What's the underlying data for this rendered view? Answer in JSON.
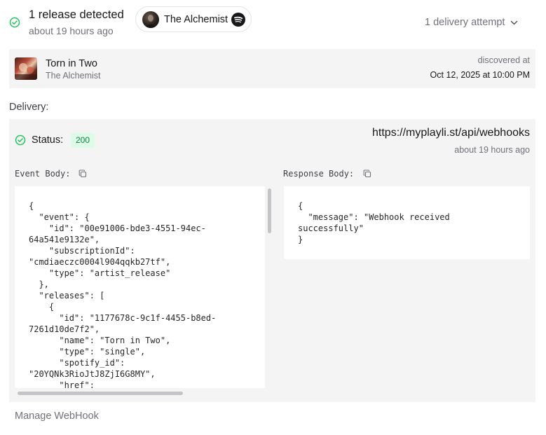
{
  "header": {
    "title": "1 release detected",
    "time": "about 19 hours ago",
    "artist_pill": {
      "name": "The Alchemist",
      "icon": "spotify-icon"
    },
    "attempts_label": "1 delivery attempt",
    "accent_color": "#22c55e"
  },
  "release": {
    "track_name": "Torn in Two",
    "artist": "The Alchemist",
    "discovered_label": "discovered at",
    "discovered_value": "Oct 12, 2025 at 10:00 PM"
  },
  "delivery": {
    "section_label": "Delivery:",
    "status_label": "Status:",
    "status_code": "200",
    "url": "https://myplayli.st/api/webhooks",
    "time": "about 19 hours ago",
    "event_body_label": "Event Body:",
    "response_body_label": "Response Body:",
    "event_body": "{\n  \"event\": {\n    \"id\": \"00e91006-bde3-4551-94ec-\n64a541e9132e\",\n    \"subscriptionId\":\n\"cmdiaeczc0004l904qqkb27tf\",\n    \"type\": \"artist_release\"\n  },\n  \"releases\": [\n    {\n      \"id\": \"1177678c-9c1f-4455-b8ed-\n7261d10de7f2\",\n      \"name\": \"Torn in Two\",\n      \"type\": \"single\",\n      \"spotify_id\":\n\"20YQNk3RioJtJ8ZjI6G8MY\",\n      \"href\":",
    "response_body": "{\n  \"message\": \"Webhook received\nsuccessfully\"\n}"
  },
  "footer": {
    "manage_label": "Manage WebHook"
  }
}
